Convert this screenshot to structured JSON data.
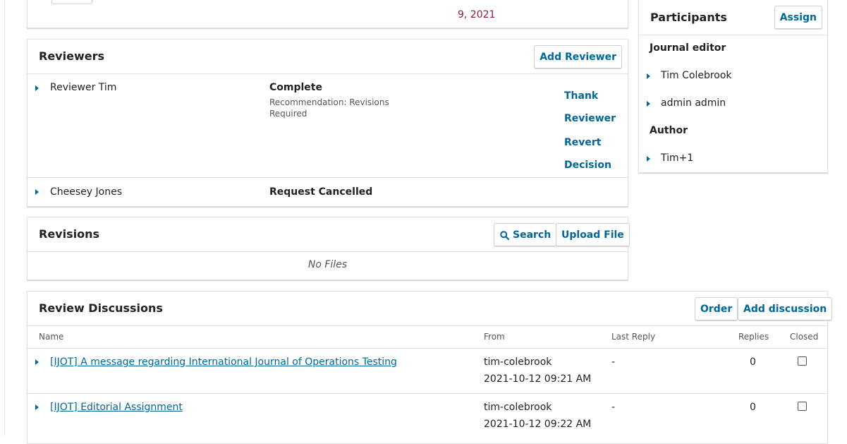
{
  "top_file": {
    "date_line": "9, 2021"
  },
  "reviewers": {
    "title": "Reviewers",
    "add_button": "Add Reviewer",
    "rows": [
      {
        "name": "Reviewer Tim",
        "status": "Complete",
        "recommendation": "Recommendation: Revisions Required",
        "actions": [
          "Thank Reviewer",
          "Revert Decision"
        ]
      },
      {
        "name": "Cheesey Jones",
        "status": "Request Cancelled"
      }
    ]
  },
  "revisions": {
    "title": "Revisions",
    "search_button": "Search",
    "upload_button": "Upload File",
    "empty_text": "No Files"
  },
  "participants": {
    "title": "Participants",
    "assign_button": "Assign",
    "groups": [
      {
        "label": "Journal editor",
        "members": [
          "Tim Colebrook",
          "admin admin"
        ]
      },
      {
        "label": "Author",
        "members": [
          "Tim+1"
        ]
      }
    ]
  },
  "discussions": {
    "title": "Review Discussions",
    "order_button": "Order",
    "add_button": "Add discussion",
    "columns": [
      "Name",
      "From",
      "Last Reply",
      "Replies",
      "Closed"
    ],
    "rows": [
      {
        "name": "[IJOT] A message regarding International Journal of Operations Testing",
        "from_user": "tim-colebrook",
        "from_date": "2021-10-12 09:21 AM",
        "last_reply": "-",
        "replies": "0"
      },
      {
        "name": "[IJOT] Editorial Assignment",
        "from_user": "tim-colebrook",
        "from_date": "2021-10-12 09:22 AM",
        "last_reply": "-",
        "replies": "0"
      }
    ]
  },
  "colors": {
    "accent": "#006798",
    "date_accent": "#8c1d3f"
  }
}
